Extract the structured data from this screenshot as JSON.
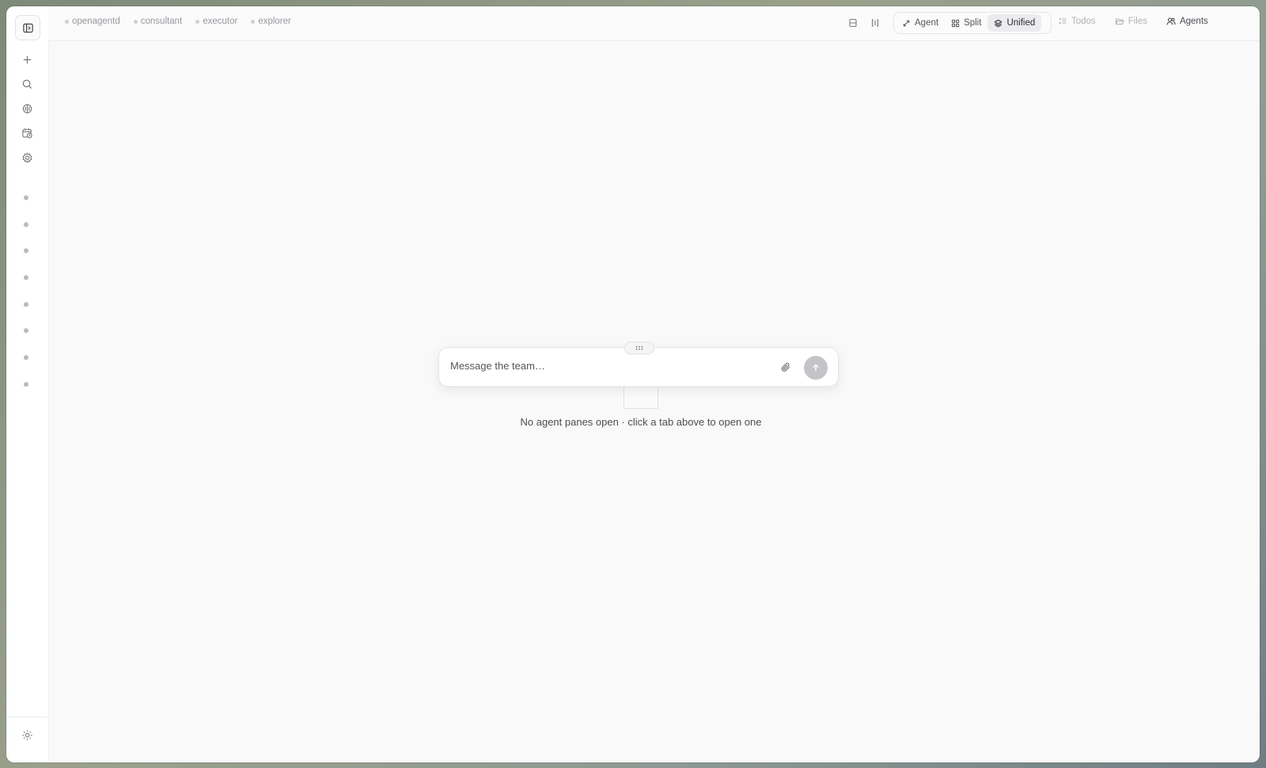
{
  "rail": {
    "toggle_icon": "sidebar-toggle-icon",
    "actions": [
      {
        "name": "new",
        "icon": "plus-icon"
      },
      {
        "name": "search",
        "icon": "search-icon"
      },
      {
        "name": "brain",
        "icon": "brain-icon"
      },
      {
        "name": "schedule",
        "icon": "calendar-clock-icon"
      },
      {
        "name": "settings",
        "icon": "gear-icon"
      }
    ],
    "bottom_icon": "sun-icon"
  },
  "topbar": {
    "agent_tabs": [
      {
        "label": "openagentd"
      },
      {
        "label": "consultant"
      },
      {
        "label": "executor"
      },
      {
        "label": "explorer"
      }
    ],
    "modes": {
      "agent": "Agent",
      "split": "Split",
      "unified": "Unified",
      "active": "unified"
    },
    "tools": {
      "todos": "Todos",
      "files": "Files",
      "agents": "Agents"
    }
  },
  "composer": {
    "placeholder": "Message the team…",
    "value": ""
  },
  "empty_state": {
    "message": "No agent panes open · click a tab above to open one"
  },
  "colors": {
    "window_bg": "#f9f9fa",
    "send_button": "#c4c4c8",
    "active_mode_bg": "#ececee"
  }
}
